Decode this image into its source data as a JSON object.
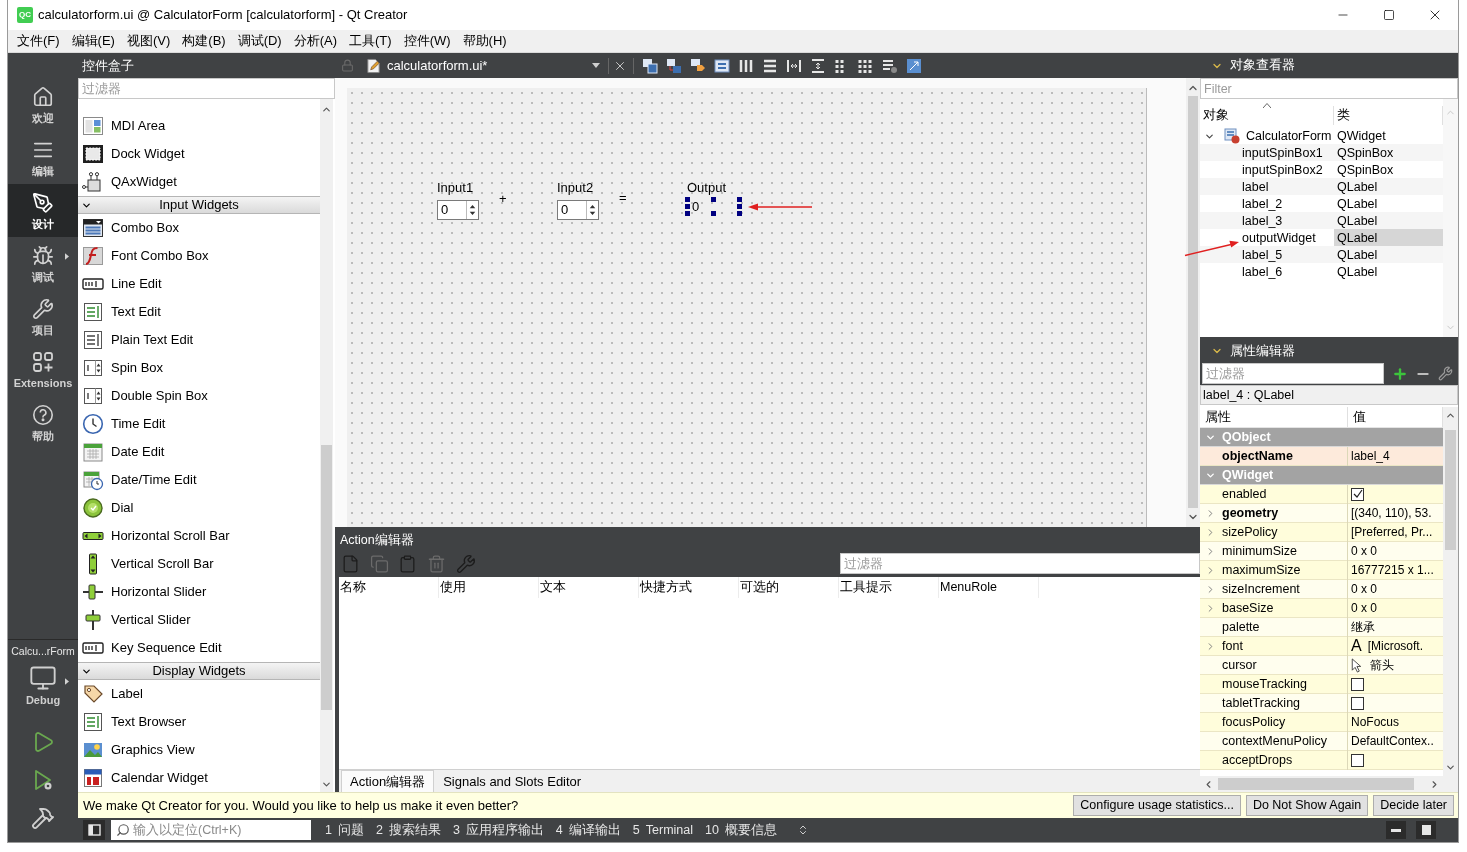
{
  "window": {
    "logo": "QC",
    "title": "calculatorform.ui @ CalculatorForm [calculatorform] - Qt Creator"
  },
  "menu": [
    "文件(F)",
    "编辑(E)",
    "视图(V)",
    "构建(B)",
    "调试(D)",
    "分析(A)",
    "工具(T)",
    "控件(W)",
    "帮助(H)"
  ],
  "modes": [
    {
      "kind": "welcome",
      "label": "欢迎",
      "selected": false
    },
    {
      "kind": "edit",
      "label": "编辑",
      "selected": false
    },
    {
      "kind": "design",
      "label": "设计",
      "selected": true
    },
    {
      "kind": "debug",
      "label": "调试",
      "selected": false
    },
    {
      "kind": "projects",
      "label": "项目",
      "selected": false
    },
    {
      "kind": "extensions",
      "label": "Extensions",
      "selected": false
    },
    {
      "kind": "help",
      "label": "帮助",
      "selected": false
    }
  ],
  "kit": {
    "project": "Calcu...rForm",
    "build": "Debug"
  },
  "widget_box": {
    "title": "控件盒子",
    "filter_placeholder": "过滤器",
    "sections": [
      {
        "items": [
          "MDI Area",
          "Dock Widget",
          "QAxWidget"
        ]
      },
      {
        "title": "Input Widgets",
        "expanded": true,
        "items": [
          "Combo Box",
          "Font Combo Box",
          "Line Edit",
          "Text Edit",
          "Plain Text Edit",
          "Spin Box",
          "Double Spin Box",
          "Time Edit",
          "Date Edit",
          "Date/Time Edit",
          "Dial",
          "Horizontal Scroll Bar",
          "Vertical Scroll Bar",
          "Horizontal Slider",
          "Vertical Slider",
          "Key Sequence Edit"
        ]
      },
      {
        "title": "Display Widgets",
        "expanded": true,
        "items": [
          "Label",
          "Text Browser",
          "Graphics View",
          "Calendar Widget"
        ]
      }
    ]
  },
  "designer": {
    "file": "calculatorform.ui*",
    "form": {
      "items": [
        {
          "kind": "label",
          "text": "Input1",
          "selected": false
        },
        {
          "kind": "spinbox",
          "value": "0",
          "selected": false
        },
        {
          "kind": "label",
          "text": "+",
          "selected": false
        },
        {
          "kind": "label",
          "text": "Input2",
          "selected": false
        },
        {
          "kind": "spinbox",
          "value": "0",
          "selected": false
        },
        {
          "kind": "label",
          "text": "=",
          "selected": false
        },
        {
          "kind": "label",
          "text": "Output",
          "selected": false
        },
        {
          "kind": "label",
          "text": "0",
          "selected": true
        }
      ]
    }
  },
  "action_editor": {
    "title": "Action编辑器",
    "filter_placeholder": "过滤器",
    "columns": [
      "名称",
      "使用",
      "文本",
      "快捷方式",
      "可选的",
      "工具提示",
      "MenuRole"
    ],
    "tabs": [
      {
        "label": "Action编辑器",
        "selected": true
      },
      {
        "label": "Signals and Slots Editor",
        "selected": false
      }
    ]
  },
  "object_inspector": {
    "title": "对象查看器",
    "filter_placeholder": "Filter",
    "columns": [
      "对象",
      "类"
    ],
    "tree": [
      {
        "object": "CalculatorForm",
        "class": "QWidget",
        "expanded": true,
        "selected": false,
        "children": [
          {
            "object": "inputSpinBox1",
            "class": "QSpinBox",
            "selected": false
          },
          {
            "object": "inputSpinBox2",
            "class": "QSpinBox",
            "selected": false
          },
          {
            "object": "label",
            "class": "QLabel",
            "selected": false
          },
          {
            "object": "label_2",
            "class": "QLabel",
            "selected": false
          },
          {
            "object": "label_3",
            "class": "QLabel",
            "selected": false
          },
          {
            "object": "outputWidget",
            "class": "QLabel",
            "selected": true
          },
          {
            "object": "label_5",
            "class": "QLabel",
            "selected": false
          },
          {
            "object": "label_6",
            "class": "QLabel",
            "selected": false
          }
        ]
      }
    ]
  },
  "property_editor": {
    "title": "属性编辑器",
    "filter_placeholder": "过滤器",
    "object": "label_4 : QLabel",
    "columns": [
      "属性",
      "值"
    ],
    "groups": [
      {
        "name": "QObject",
        "expanded": true,
        "properties": [
          {
            "name": "objectName",
            "kind": "text",
            "value": "label_4",
            "modified": true,
            "expandable": false
          }
        ]
      },
      {
        "name": "QWidget",
        "expanded": true,
        "properties": [
          {
            "name": "enabled",
            "kind": "checkbox",
            "checked": true,
            "modified": false,
            "expandable": false
          },
          {
            "name": "geometry",
            "kind": "text",
            "value": "[(340, 110), 53.",
            "modified": true,
            "expandable": true
          },
          {
            "name": "sizePolicy",
            "kind": "text",
            "value": "[Preferred, Pr...",
            "modified": false,
            "expandable": true
          },
          {
            "name": "minimumSize",
            "kind": "text",
            "value": "0 x 0",
            "modified": false,
            "expandable": true
          },
          {
            "name": "maximumSize",
            "kind": "text",
            "value": "16777215 x 1...",
            "modified": false,
            "expandable": true
          },
          {
            "name": "sizeIncrement",
            "kind": "text",
            "value": "0 x 0",
            "modified": false,
            "expandable": true
          },
          {
            "name": "baseSize",
            "kind": "text",
            "value": "0 x 0",
            "modified": false,
            "expandable": true
          },
          {
            "name": "palette",
            "kind": "text",
            "value": "继承",
            "modified": false,
            "expandable": false
          },
          {
            "name": "font",
            "kind": "font",
            "sample": "A",
            "value": "[Microsoft.",
            "modified": false,
            "expandable": true
          },
          {
            "name": "cursor",
            "kind": "cursor",
            "value": "箭头",
            "modified": false,
            "expandable": false
          },
          {
            "name": "mouseTracking",
            "kind": "checkbox",
            "checked": false,
            "modified": false,
            "expandable": false
          },
          {
            "name": "tabletTracking",
            "kind": "checkbox",
            "checked": false,
            "modified": false,
            "expandable": false
          },
          {
            "name": "focusPolicy",
            "kind": "text",
            "value": "NoFocus",
            "modified": false,
            "expandable": false
          },
          {
            "name": "contextMenuPolicy",
            "kind": "text",
            "value": "DefaultContex..",
            "modified": false,
            "expandable": false
          },
          {
            "name": "acceptDrops",
            "kind": "checkbox",
            "checked": false,
            "modified": false,
            "expandable": false
          }
        ]
      }
    ]
  },
  "info_bar": {
    "message": "We make Qt Creator for you. Would you like to help us make it even better?",
    "buttons": [
      "Configure usage statistics...",
      "Do Not Show Again",
      "Decide later"
    ]
  },
  "status_bar": {
    "locator_placeholder": "输入以定位(Ctrl+K)",
    "panes": [
      {
        "number": "1",
        "label": "问题"
      },
      {
        "number": "2",
        "label": "搜索结果"
      },
      {
        "number": "3",
        "label": "应用程序输出"
      },
      {
        "number": "4",
        "label": "编译输出"
      },
      {
        "number": "5",
        "label": "Terminal"
      },
      {
        "number": "10",
        "label": "概要信息"
      }
    ]
  }
}
